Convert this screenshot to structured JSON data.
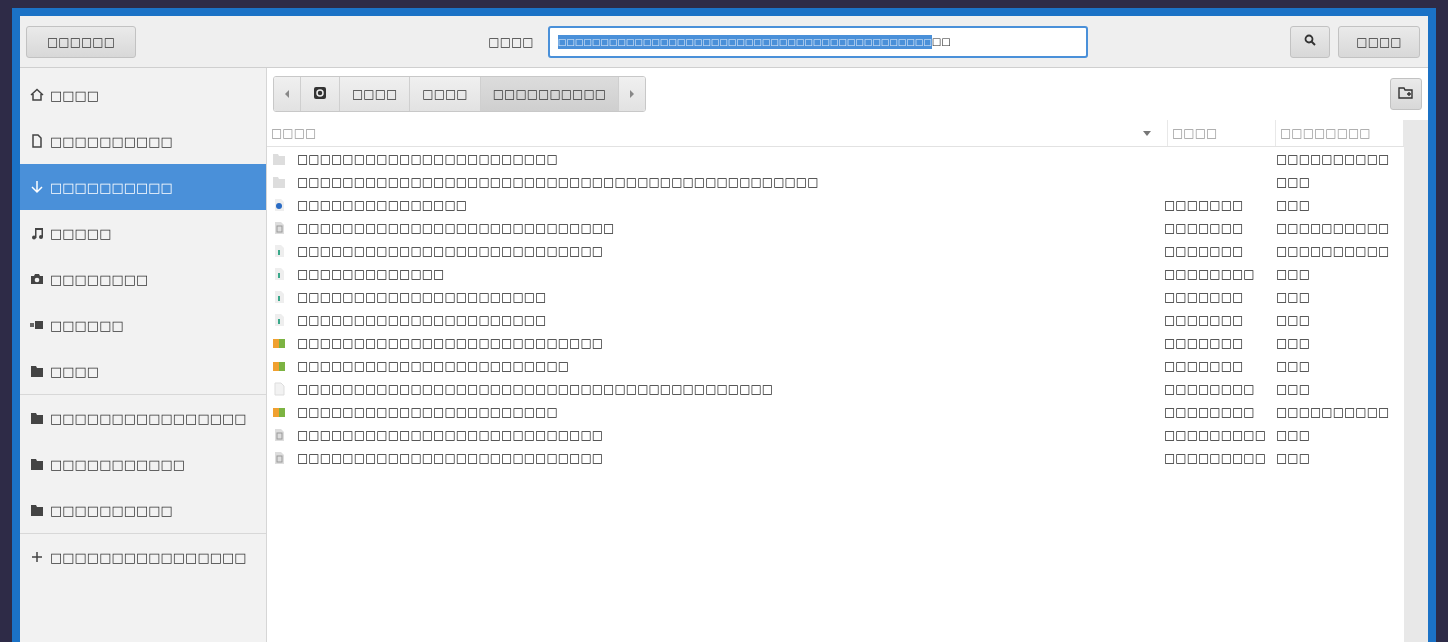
{
  "header": {
    "left_button": "□□□□□□",
    "name_label": "□□□□",
    "name_field": {
      "selected_text": "□□□□□□□□□□□□□□□□□□□□□□□□□□□□□□□□□□□□□□□□□□□□",
      "text": "□□"
    },
    "right_button": "□□□□"
  },
  "sidebar": {
    "groups": [
      [
        {
          "kind": "home",
          "label": "□□□□",
          "selected": false
        },
        {
          "kind": "document",
          "label": "□□□□□□□□□□",
          "selected": false
        },
        {
          "kind": "download",
          "label": "□□□□□□□□□□",
          "selected": true
        },
        {
          "kind": "music",
          "label": "□□□□□",
          "selected": false
        },
        {
          "kind": "camera",
          "label": "□□□□□□□□",
          "selected": false
        },
        {
          "kind": "video",
          "label": "□□□□□□",
          "selected": false
        },
        {
          "kind": "folder",
          "label": "□□□□",
          "selected": false
        }
      ],
      [
        {
          "kind": "folder",
          "label": "□□□□□□□□□□□□□□□□",
          "selected": false
        },
        {
          "kind": "folder",
          "label": "□□□□□□□□□□□",
          "selected": false
        },
        {
          "kind": "folder",
          "label": "□□□□□□□□□□",
          "selected": false
        }
      ],
      [
        {
          "kind": "add",
          "label": "□□□□□□□□□□□□□□□□",
          "selected": false
        }
      ]
    ]
  },
  "path_bar": [
    {
      "label": "□□□□",
      "selected": false
    },
    {
      "label": "□□□□",
      "selected": false
    },
    {
      "label": "□□□□□□□□□□",
      "selected": true
    }
  ],
  "table": {
    "columns": [
      "□□□□",
      "□□□□",
      "□□□□□□□□"
    ],
    "rows": [
      {
        "kind": "folder",
        "name": "□□□□□□□□□□□□□□□□□□□□□□□",
        "size": "",
        "modified": "□□□□□□□□□□"
      },
      {
        "kind": "folder",
        "name": "□□□□□□□□□□□□□□□□□□□□□□□□□□□□□□□□□□□□□□□□□□□□□□",
        "size": "",
        "modified": "□□□"
      },
      {
        "kind": "web",
        "name": "□□□□□□□□□□□□□□□",
        "size": "□□□□□□□",
        "modified": "□□□"
      },
      {
        "kind": "image",
        "name": "□□□□□□□□□□□□□□□□□□□□□□□□□□□□",
        "size": "□□□□□□□",
        "modified": "□□□□□□□□□□"
      },
      {
        "kind": "sheet",
        "name": "□□□□□□□□□□□□□□□□□□□□□□□□□□□",
        "size": "□□□□□□□",
        "modified": "□□□□□□□□□□"
      },
      {
        "kind": "sheet",
        "name": "□□□□□□□□□□□□□",
        "size": "□□□□□□□□",
        "modified": "□□□"
      },
      {
        "kind": "sheet",
        "name": "□□□□□□□□□□□□□□□□□□□□□□",
        "size": "□□□□□□□",
        "modified": "□□□"
      },
      {
        "kind": "sheet",
        "name": "□□□□□□□□□□□□□□□□□□□□□□",
        "size": "□□□□□□□",
        "modified": "□□□"
      },
      {
        "kind": "archive",
        "name": "□□□□□□□□□□□□□□□□□□□□□□□□□□□",
        "size": "□□□□□□□",
        "modified": "□□□"
      },
      {
        "kind": "archive",
        "name": "□□□□□□□□□□□□□□□□□□□□□□□□",
        "size": "□□□□□□□",
        "modified": "□□□"
      },
      {
        "kind": "text",
        "name": "□□□□□□□□□□□□□□□□□□□□□□□□□□□□□□□□□□□□□□□□□□",
        "size": "□□□□□□□□",
        "modified": "□□□"
      },
      {
        "kind": "archive",
        "name": "□□□□□□□□□□□□□□□□□□□□□□□",
        "size": "□□□□□□□□",
        "modified": "□□□□□□□□□□"
      },
      {
        "kind": "image",
        "name": "□□□□□□□□□□□□□□□□□□□□□□□□□□□",
        "size": "□□□□□□□□□",
        "modified": "□□□"
      },
      {
        "kind": "image",
        "name": "□□□□□□□□□□□□□□□□□□□□□□□□□□□",
        "size": "□□□□□□□□□",
        "modified": "□□□"
      }
    ]
  }
}
